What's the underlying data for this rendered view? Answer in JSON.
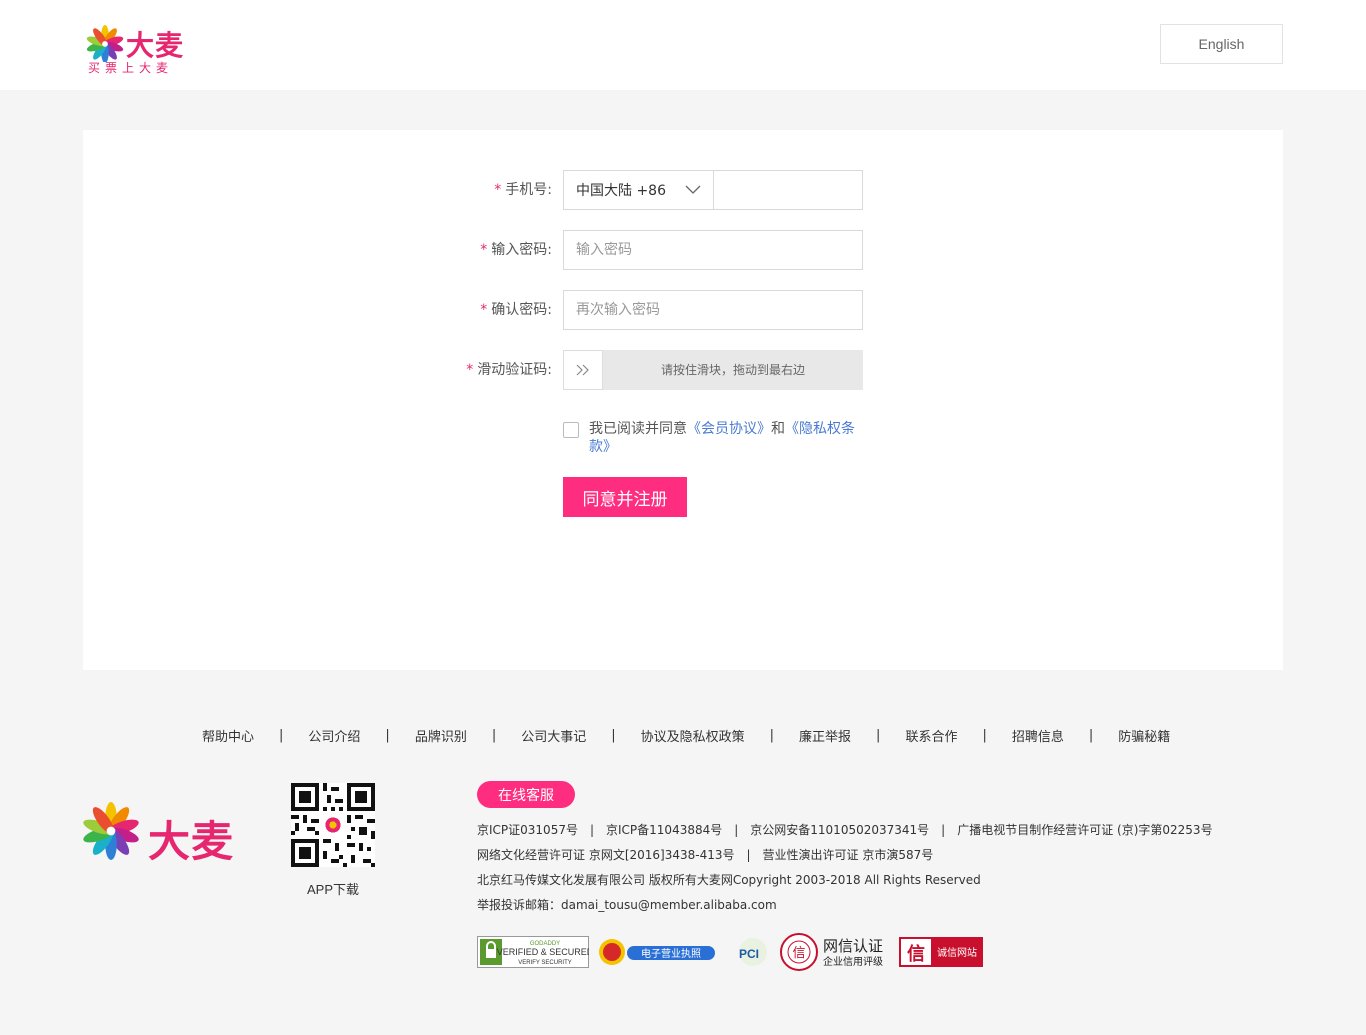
{
  "header": {
    "logo_text": "大麦",
    "logo_slogan": "买票上大麦",
    "lang_button": "English"
  },
  "form": {
    "phone": {
      "label": "手机号:",
      "country": "中国大陆 +86",
      "value": ""
    },
    "password": {
      "label": "输入密码:",
      "placeholder": "输入密码"
    },
    "confirm": {
      "label": "确认密码:",
      "placeholder": "再次输入密码"
    },
    "slider": {
      "label": "滑动验证码:",
      "hint": "请按住滑块，拖动到最右边"
    },
    "required_mark": "*",
    "agree": {
      "prefix": "我已阅读并同意",
      "member_link": "《会员协议》",
      "and": "和",
      "privacy_link": "《隐私权条款》",
      "checked": false
    },
    "submit": "同意并注册"
  },
  "footer": {
    "links": [
      "帮助中心",
      "公司介绍",
      "品牌识别",
      "公司大事记",
      "协议及隐私权政策",
      "廉正举报",
      "联系合作",
      "招聘信息",
      "防骗秘籍"
    ],
    "separator": "|",
    "logo_text": "大麦",
    "app_download": "APP下载",
    "service_button": "在线客服",
    "lines": [
      "京ICP证031057号　|　京ICP备11043884号　|　京公网安备11010502037341号　|　广播电视节目制作经营许可证 (京)字第02253号",
      "网络文化经营许可证 京网文[2016]3438-413号　|　营业性演出许可证 京市演587号",
      "北京红马传媒文化发展有限公司 版权所有大麦网Copyright 2003-2018 All Rights Reserved",
      "举报投诉邮箱：damai_tousu@member.alibaba.com"
    ],
    "badges": {
      "godaddy_top": "GODADDY",
      "godaddy_main": "VERIFIED & SECURED",
      "godaddy_bottom": "VERIFY SECURITY",
      "license": "电子营业执照",
      "pci": "PCI",
      "trust_seal": "信",
      "wangxin_title": "网信认证",
      "wangxin_sub": "企业信用评级",
      "chengxin": "诚信网站",
      "chengxin_icon": "信"
    }
  },
  "colors": {
    "brand": "#e6266f",
    "button": "#ff2d7f",
    "link": "#4a7bd0"
  }
}
